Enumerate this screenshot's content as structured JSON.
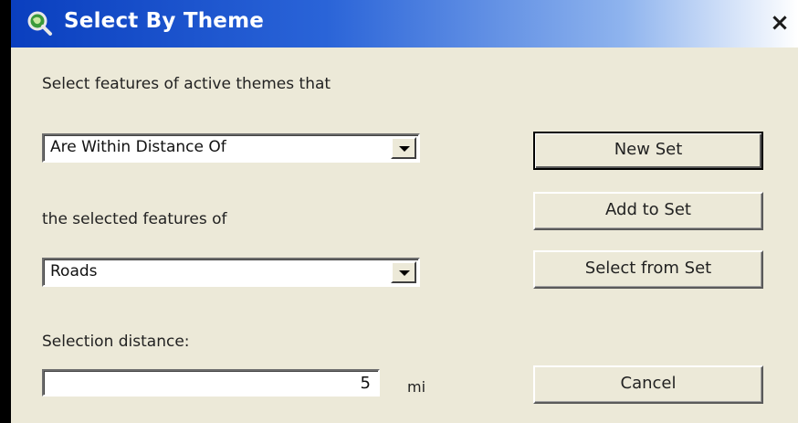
{
  "window": {
    "title": "Select By Theme",
    "close_symbol": "×",
    "icon": "magnifier-globe-icon"
  },
  "form": {
    "intro_label": "Select features of active themes that",
    "relation_select": {
      "selected": "Are Within Distance Of"
    },
    "target_label": "the selected features of",
    "theme_select": {
      "selected": "Roads"
    },
    "distance_label": "Selection distance:",
    "distance_value": "5",
    "distance_unit": "mi"
  },
  "buttons": {
    "new_set": "New Set",
    "add_to_set": "Add to Set",
    "select_from_set": "Select from Set",
    "cancel": "Cancel"
  },
  "colors": {
    "titlebar_start": "#0a3fbf",
    "titlebar_end": "#ffffff",
    "dialog_background": "#ece9d8"
  }
}
